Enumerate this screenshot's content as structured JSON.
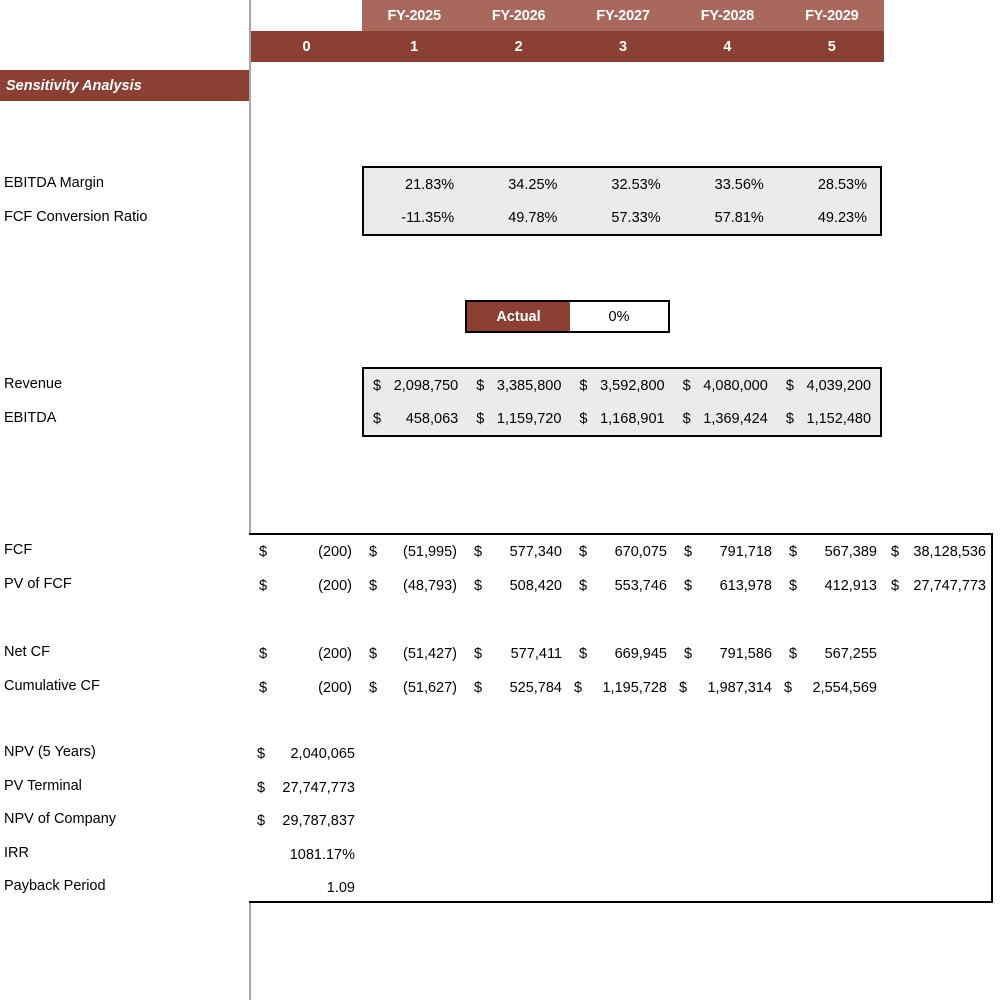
{
  "header": {
    "fiscal_years": [
      "FY-2025",
      "FY-2026",
      "FY-2027",
      "FY-2028",
      "FY-2029"
    ],
    "periods": [
      "0",
      "1",
      "2",
      "3",
      "4",
      "5"
    ]
  },
  "sensitivity": {
    "banner_title": "Sensitivity Analysis"
  },
  "ratios": {
    "labels": [
      "EBITDA Margin",
      "FCF Conversion Ratio"
    ],
    "ebitda_margin": [
      "21.83%",
      "34.25%",
      "32.53%",
      "33.56%",
      "28.53%"
    ],
    "fcf_conversion_ratio": [
      "-11.35%",
      "49.78%",
      "57.33%",
      "57.81%",
      "49.23%"
    ]
  },
  "scenario": {
    "label": "Actual",
    "value": "0%"
  },
  "financials": {
    "labels": [
      "Revenue",
      "EBITDA"
    ],
    "revenue": [
      {
        "sym": "$",
        "amt": "2,098,750"
      },
      {
        "sym": "$",
        "amt": "3,385,800"
      },
      {
        "sym": "$",
        "amt": "3,592,800"
      },
      {
        "sym": "$",
        "amt": "4,080,000"
      },
      {
        "sym": "$",
        "amt": "4,039,200"
      }
    ],
    "ebitda": [
      {
        "sym": "$",
        "amt": "458,063"
      },
      {
        "sym": "$",
        "amt": "1,159,720"
      },
      {
        "sym": "$",
        "amt": "1,168,901"
      },
      {
        "sym": "$",
        "amt": "1,369,424"
      },
      {
        "sym": "$",
        "amt": "1,152,480"
      }
    ]
  },
  "cashflow": {
    "labels": {
      "fcf": "FCF",
      "pv_of_fcf": "PV of FCF",
      "net_cf": "Net CF",
      "cumulative_cf": "Cumulative CF"
    },
    "fcf": [
      {
        "sym": "$",
        "amt": "(200)"
      },
      {
        "sym": "$",
        "amt": "(51,995)"
      },
      {
        "sym": "$",
        "amt": "577,340"
      },
      {
        "sym": "$",
        "amt": "670,075"
      },
      {
        "sym": "$",
        "amt": "791,718"
      },
      {
        "sym": "$",
        "amt": "567,389"
      },
      {
        "sym": "$",
        "amt": "38,128,536"
      }
    ],
    "pv_of_fcf": [
      {
        "sym": "$",
        "amt": "(200)"
      },
      {
        "sym": "$",
        "amt": "(48,793)"
      },
      {
        "sym": "$",
        "amt": "508,420"
      },
      {
        "sym": "$",
        "amt": "553,746"
      },
      {
        "sym": "$",
        "amt": "613,978"
      },
      {
        "sym": "$",
        "amt": "412,913"
      },
      {
        "sym": "$",
        "amt": "27,747,773"
      }
    ],
    "net_cf": [
      {
        "sym": "$",
        "amt": "(200)"
      },
      {
        "sym": "$",
        "amt": "(51,427)"
      },
      {
        "sym": "$",
        "amt": "577,411"
      },
      {
        "sym": "$",
        "amt": "669,945"
      },
      {
        "sym": "$",
        "amt": "791,586"
      },
      {
        "sym": "$",
        "amt": "567,255"
      }
    ],
    "cumulative_cf": [
      {
        "sym": "$",
        "amt": "(200)"
      },
      {
        "sym": "$",
        "amt": "(51,627)"
      },
      {
        "sym": "$",
        "amt": "525,784"
      },
      {
        "sym": "$",
        "amt": "1,195,728"
      },
      {
        "sym": "$",
        "amt": "1,987,314"
      },
      {
        "sym": "$",
        "amt": "2,554,569"
      }
    ]
  },
  "valuation": {
    "rows": [
      {
        "label": "NPV (5 Years)",
        "sym": "$",
        "amt": "2,040,065"
      },
      {
        "label": "PV Terminal",
        "sym": "$",
        "amt": "27,747,773"
      },
      {
        "label": "NPV of Company",
        "sym": "$",
        "amt": "29,787,837"
      },
      {
        "label": "IRR",
        "sym": "",
        "amt": "1081.17%"
      },
      {
        "label": "Payback Period",
        "sym": "",
        "amt": "1.09"
      }
    ]
  },
  "colors": {
    "header_light_brown": "#a8695c",
    "header_dark_brown": "#8c4033",
    "gray_fill": "#ebebeb",
    "divider_gray": "#a6a6a6"
  }
}
